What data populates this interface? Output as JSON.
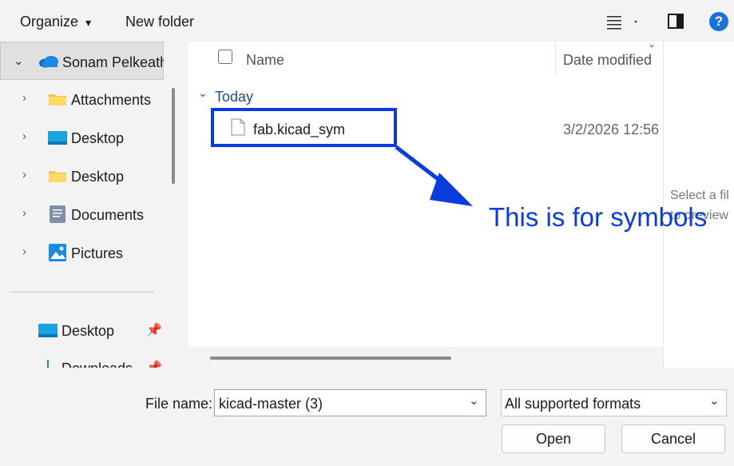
{
  "toolbar": {
    "organize_label": "Organize",
    "organize_caret": "▾",
    "new_folder_label": "New folder",
    "help_glyph": "?"
  },
  "sidebar": {
    "account_label": "Sonam Pelkeath",
    "items": [
      {
        "label": "Attachments",
        "icon": "folder-icon"
      },
      {
        "label": "Desktop",
        "icon": "desktop-icon"
      },
      {
        "label": "Desktop",
        "icon": "folder-icon"
      },
      {
        "label": "Documents",
        "icon": "documents-icon"
      },
      {
        "label": "Pictures",
        "icon": "pictures-icon"
      }
    ],
    "pinned": [
      {
        "label": "Desktop",
        "icon": "desktop-icon"
      },
      {
        "label": "Downloads",
        "icon": "downloads-icon"
      }
    ]
  },
  "file_list": {
    "columns": {
      "name": "Name",
      "date_modified": "Date modified"
    },
    "group_label": "Today",
    "files": [
      {
        "name": "fab.kicad_sym",
        "date_modified": "3/2/2026 12:56"
      }
    ]
  },
  "preview": {
    "line1": "Select a fil",
    "line2": "to preview"
  },
  "annotation": {
    "text": "This is for symbols",
    "color": "#0a3be0"
  },
  "bottom": {
    "file_name_label": "File name:",
    "file_name_value": "kicad-master (3)",
    "format_value": "All supported formats",
    "open_label": "Open",
    "cancel_label": "Cancel"
  }
}
